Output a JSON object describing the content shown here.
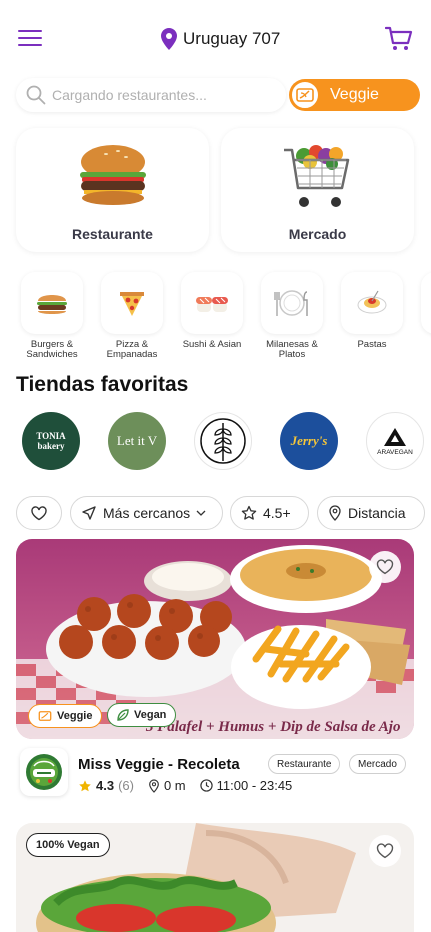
{
  "header": {
    "location": "Uruguay 707"
  },
  "search": {
    "placeholder": "Cargando restaurantes...",
    "veggie_label": "Veggie"
  },
  "sections": [
    {
      "label": "Restaurante"
    },
    {
      "label": "Mercado"
    }
  ],
  "categories": [
    {
      "label": "Burgers & Sandwiches",
      "icon": "burger-icon"
    },
    {
      "label": "Pizza & Empanadas",
      "icon": "pizza-icon"
    },
    {
      "label": "Sushi & Asian",
      "icon": "sushi-icon"
    },
    {
      "label": "Milanesas & Platos",
      "icon": "plate-icon"
    },
    {
      "label": "Pastas",
      "icon": "pasta-icon"
    }
  ],
  "favorites": {
    "title": "Tiendas favoritas",
    "stores": [
      {
        "name": "TONIA bakery",
        "color": "#1f4f3a"
      },
      {
        "name": "Let it V",
        "color": "#6d8f5a"
      },
      {
        "name": "",
        "color": "#ffffff"
      },
      {
        "name": "Jerry's",
        "color": "#1c4f9c"
      },
      {
        "name": "ARAVEGAN",
        "color": "#ffffff"
      }
    ]
  },
  "filters": {
    "sort_label": "Más cercanos",
    "rating_label": "4.5+",
    "distance_label": "Distancia"
  },
  "stores": [
    {
      "name": "Miss Veggie - Recoleta",
      "rating": "4.3",
      "reviews": "(6)",
      "distance": "0 m",
      "hours": "11:00 - 23:45",
      "tags": [
        "Veggie",
        "Vegan"
      ],
      "types": [
        "Restaurante",
        "Mercado"
      ],
      "image_caption": "3 Falafel + Humus + Dip de Salsa de Ajo"
    },
    {
      "badge": "100% Vegan"
    }
  ],
  "colors": {
    "brand_purple": "#7b2fbe",
    "accent_orange": "#f7931e",
    "veggie_green": "#3e8e41",
    "star": "#f0b400"
  }
}
